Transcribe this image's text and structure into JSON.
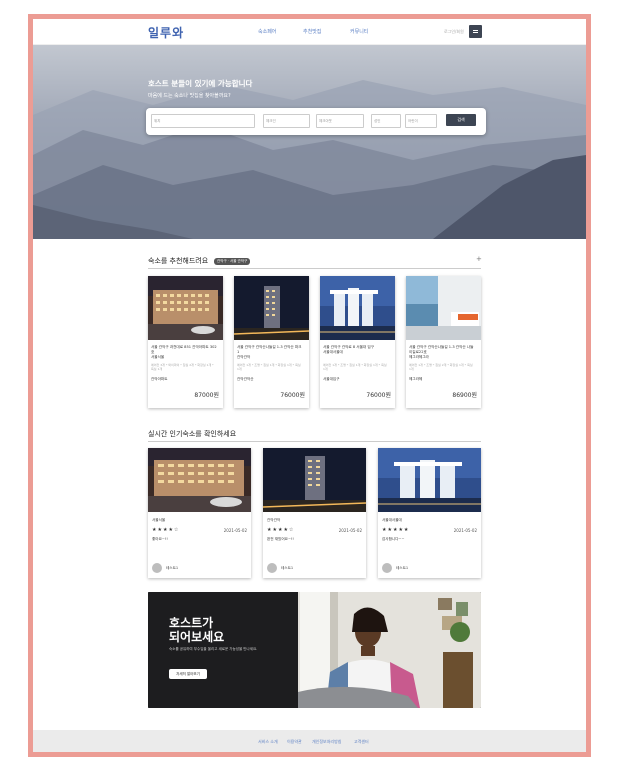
{
  "header": {
    "logo": "일루와",
    "nav": [
      "숙소페어",
      "추천맛집",
      "커뮤니티"
    ],
    "login": "로그인/회원"
  },
  "hero": {
    "title": "호스트 분들이 있기에 가능합니다",
    "subtitle": "마음에 드는 숙소나 맛집을 찾아볼까요?",
    "search": {
      "location_placeholder": "위치",
      "checkin_placeholder": "체크인",
      "checkout_placeholder": "체크아웃",
      "adult_placeholder": "성인",
      "child_placeholder": "어린이",
      "button": "검색"
    }
  },
  "recommend": {
    "title": "숙소를 추천해드려요",
    "tag": "관악구 · 서울 관악구",
    "plus": "+",
    "cards": [
      {
        "addr": "서울 관악구 과천대로 851 관악아파트 302호",
        "addr2": "서울서울",
        "opts": "에어컨 3개 * 와이파이 * 침실 2개 * 화장실 1개 * 욕실 1개",
        "station": "관악아파트",
        "price": "87000원"
      },
      {
        "addr": "서울 관악구 관악산나들길 1-3 관악산 파크1",
        "addr2": "관악관악",
        "opts": "에어컨 1개 * 조명 * 침실 1개 * 화장실 1개 * 욕실 1개",
        "station": "관악관악산",
        "price": "76000원"
      },
      {
        "addr": "서울 관악구 관악로 8 서울대 입구",
        "addr2": "서울대서울대",
        "opts": "에어컨 1개 * 조명 * 침실 1개 * 화장실 1개 * 욕실 1개",
        "station": "서울대입구",
        "price": "76000원"
      },
      {
        "addr": "서울 관악구 관악산나들길 1-3 관악산 나들이길로22호",
        "addr2": "헤그라헤그라",
        "opts": "에어컨 1개 * 조명 * 침실 2개 * 화장실 1개 * 욕실 1개",
        "station": "헤그라헤",
        "price": "86900원"
      }
    ]
  },
  "popular": {
    "title": "실시간 인기숙소를 확인하세요",
    "cards": [
      {
        "loc": "서울서울",
        "stars": "★★★★☆",
        "date": "2021-05-02",
        "review": "좋아요~!!",
        "user": "테스트1"
      },
      {
        "loc": "관악관악",
        "stars": "★★★★☆",
        "date": "2021-05-02",
        "review": "완전 재밌어요~!!",
        "user": "테스트1"
      },
      {
        "loc": "서울대서울대",
        "stars": "★★★★★",
        "date": "2021-05-02",
        "review": "감사합니다~~",
        "user": "테스트1"
      }
    ]
  },
  "banner": {
    "title_line1": "호스트가",
    "title_line2": "되어보세요",
    "subtitle": "숙소를 공유하여 부수입을 올리고 새로운 가능성을 만나세요.",
    "button": "자세히 알아보기"
  },
  "footer": {
    "links": [
      "서비스 소개",
      "이용약관",
      "개인정보처리방침",
      "고객센터"
    ]
  }
}
